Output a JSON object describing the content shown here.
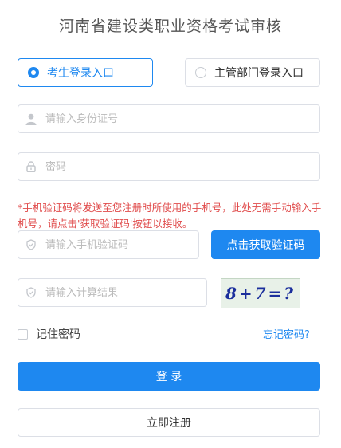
{
  "page": {
    "title": "河南省建设类职业资格考试审核"
  },
  "tabs": [
    {
      "label": "考生登录入口",
      "selected": true
    },
    {
      "label": "主管部门登录入口",
      "selected": false
    }
  ],
  "fields": {
    "id_number": {
      "placeholder": "请输入身份证号",
      "value": "",
      "icon": "user-icon"
    },
    "password": {
      "placeholder": "密码",
      "value": "",
      "icon": "lock-icon"
    },
    "sms_code": {
      "placeholder": "请输入手机验证码",
      "value": "",
      "icon": "shield-icon"
    },
    "calc_result": {
      "placeholder": "请输入计算结果",
      "value": "",
      "icon": "shield-icon"
    }
  },
  "notice": "*手机验证码将发送至您注册时所使用的手机号，此处无需手动输入手机号，请点击'获取验证码'按钮以接收。",
  "buttons": {
    "get_code": "点击获取验证码",
    "login": "登 录",
    "register": "立即注册"
  },
  "captcha": {
    "text": "8+7=?"
  },
  "remember": {
    "label": "记住密码",
    "checked": false
  },
  "forgot": {
    "label": "忘记密码?"
  },
  "colors": {
    "accent": "#1e88f0",
    "notice": "#e04b4b",
    "border": "#dcdfe6"
  }
}
